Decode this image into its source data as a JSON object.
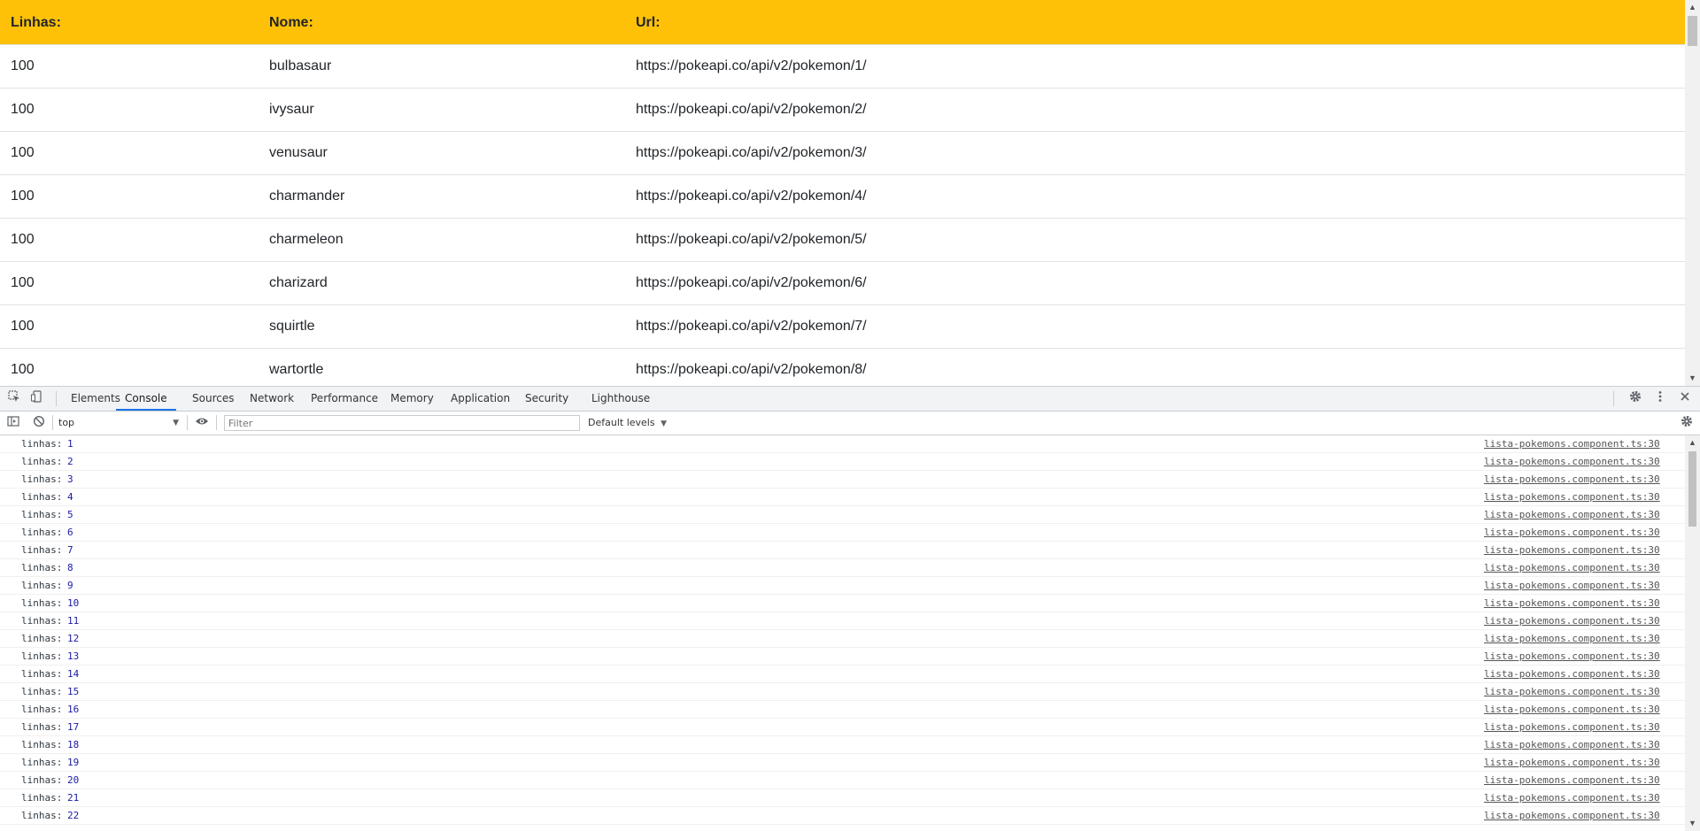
{
  "table": {
    "headers": [
      "Linhas:",
      "Nome:",
      "Url:"
    ],
    "rows": [
      {
        "linhas": "100",
        "nome": "bulbasaur",
        "url": "https://pokeapi.co/api/v2/pokemon/1/"
      },
      {
        "linhas": "100",
        "nome": "ivysaur",
        "url": "https://pokeapi.co/api/v2/pokemon/2/"
      },
      {
        "linhas": "100",
        "nome": "venusaur",
        "url": "https://pokeapi.co/api/v2/pokemon/3/"
      },
      {
        "linhas": "100",
        "nome": "charmander",
        "url": "https://pokeapi.co/api/v2/pokemon/4/"
      },
      {
        "linhas": "100",
        "nome": "charmeleon",
        "url": "https://pokeapi.co/api/v2/pokemon/5/"
      },
      {
        "linhas": "100",
        "nome": "charizard",
        "url": "https://pokeapi.co/api/v2/pokemon/6/"
      },
      {
        "linhas": "100",
        "nome": "squirtle",
        "url": "https://pokeapi.co/api/v2/pokemon/7/"
      },
      {
        "linhas": "100",
        "nome": "wartortle",
        "url": "https://pokeapi.co/api/v2/pokemon/8/"
      }
    ]
  },
  "colors": {
    "header_bg": "#ffc107",
    "active_tab": "#1a73e8",
    "log_number": "#1a1aa6"
  },
  "devtools": {
    "tabs": [
      "Elements",
      "Console",
      "Sources",
      "Network",
      "Performance",
      "Memory",
      "Application",
      "Security",
      "Lighthouse"
    ],
    "active_tab": "Console",
    "icons": {
      "inspect": "inspect-element-icon",
      "device": "device-toolbar-icon",
      "settings": "gear-icon",
      "more": "more-vertical-icon",
      "close": "close-icon",
      "sidebar": "sidebar-toggle-icon",
      "clear": "clear-console-icon",
      "eye": "eye-icon",
      "console_settings": "gear-icon"
    },
    "toolbar": {
      "context": "top",
      "filter_placeholder": "Filter",
      "filter_value": "",
      "levels": "Default levels"
    },
    "console_logs": [
      {
        "label": "linhas:",
        "value": "1",
        "source": "lista-pokemons.component.ts:30"
      },
      {
        "label": "linhas:",
        "value": "2",
        "source": "lista-pokemons.component.ts:30"
      },
      {
        "label": "linhas:",
        "value": "3",
        "source": "lista-pokemons.component.ts:30"
      },
      {
        "label": "linhas:",
        "value": "4",
        "source": "lista-pokemons.component.ts:30"
      },
      {
        "label": "linhas:",
        "value": "5",
        "source": "lista-pokemons.component.ts:30"
      },
      {
        "label": "linhas:",
        "value": "6",
        "source": "lista-pokemons.component.ts:30"
      },
      {
        "label": "linhas:",
        "value": "7",
        "source": "lista-pokemons.component.ts:30"
      },
      {
        "label": "linhas:",
        "value": "8",
        "source": "lista-pokemons.component.ts:30"
      },
      {
        "label": "linhas:",
        "value": "9",
        "source": "lista-pokemons.component.ts:30"
      },
      {
        "label": "linhas:",
        "value": "10",
        "source": "lista-pokemons.component.ts:30"
      },
      {
        "label": "linhas:",
        "value": "11",
        "source": "lista-pokemons.component.ts:30"
      },
      {
        "label": "linhas:",
        "value": "12",
        "source": "lista-pokemons.component.ts:30"
      },
      {
        "label": "linhas:",
        "value": "13",
        "source": "lista-pokemons.component.ts:30"
      },
      {
        "label": "linhas:",
        "value": "14",
        "source": "lista-pokemons.component.ts:30"
      },
      {
        "label": "linhas:",
        "value": "15",
        "source": "lista-pokemons.component.ts:30"
      },
      {
        "label": "linhas:",
        "value": "16",
        "source": "lista-pokemons.component.ts:30"
      },
      {
        "label": "linhas:",
        "value": "17",
        "source": "lista-pokemons.component.ts:30"
      },
      {
        "label": "linhas:",
        "value": "18",
        "source": "lista-pokemons.component.ts:30"
      },
      {
        "label": "linhas:",
        "value": "19",
        "source": "lista-pokemons.component.ts:30"
      },
      {
        "label": "linhas:",
        "value": "20",
        "source": "lista-pokemons.component.ts:30"
      },
      {
        "label": "linhas:",
        "value": "21",
        "source": "lista-pokemons.component.ts:30"
      },
      {
        "label": "linhas:",
        "value": "22",
        "source": "lista-pokemons.component.ts:30"
      }
    ]
  }
}
